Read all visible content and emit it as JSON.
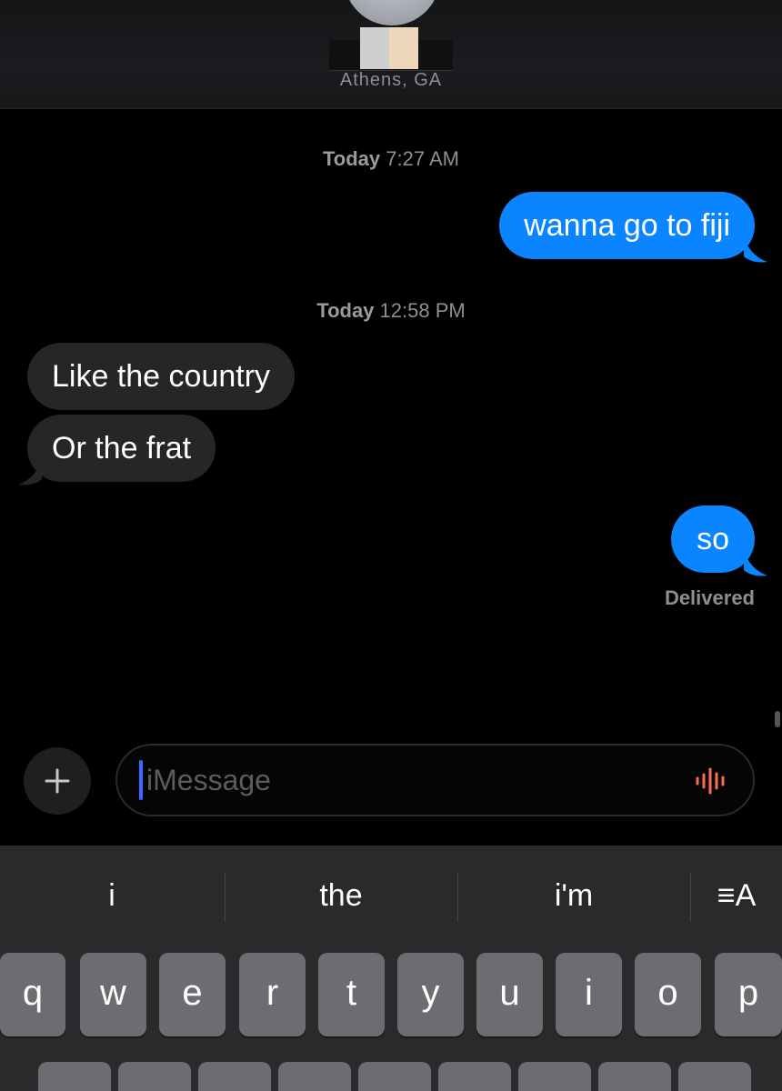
{
  "header": {
    "location": "Athens, GA"
  },
  "conversation": {
    "timestamps": [
      {
        "day": "Today",
        "time": "7:27 AM"
      },
      {
        "day": "Today",
        "time": "12:58 PM"
      }
    ],
    "messages": [
      {
        "direction": "sent",
        "text": "wanna go to fiji"
      },
      {
        "direction": "received",
        "text": "Like the country"
      },
      {
        "direction": "received",
        "text": "Or the frat"
      },
      {
        "direction": "sent",
        "text": "so"
      }
    ],
    "status": "Delivered"
  },
  "composer": {
    "placeholder": "iMessage",
    "plus_icon": "plus-icon",
    "audio_icon": "waveform-icon"
  },
  "keyboard": {
    "suggestions": [
      "i",
      "the",
      "i'm"
    ],
    "format_icon": "≡A",
    "row1": [
      "q",
      "w",
      "e",
      "r",
      "t",
      "y",
      "u",
      "i",
      "o",
      "p"
    ]
  },
  "colors": {
    "sent_bubble": "#0a84ff",
    "received_bubble": "#262628",
    "background": "#000000",
    "audio_accent": "#ff6a55"
  }
}
